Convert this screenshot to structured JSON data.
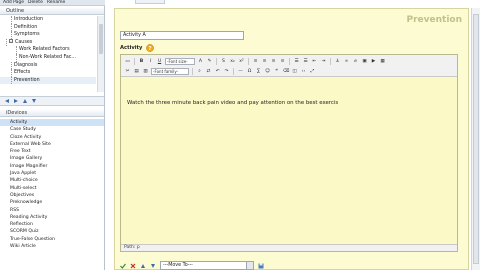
{
  "menu": {
    "items": [
      "Add Page",
      "Delete",
      "Rename"
    ]
  },
  "outline": {
    "title": "Outline",
    "items": [
      {
        "label": "Introduction",
        "indent": 2
      },
      {
        "label": "Definition",
        "indent": 2
      },
      {
        "label": "Symptoms",
        "indent": 2
      },
      {
        "label": "Causes",
        "indent": 1,
        "expander": "-"
      },
      {
        "label": "Work Related Factors",
        "indent": 3
      },
      {
        "label": "Non-Work Related Fac...",
        "indent": 3
      },
      {
        "label": "Diagnosis",
        "indent": 2
      },
      {
        "label": "Effects",
        "indent": 2
      },
      {
        "label": "Prevention",
        "indent": 2,
        "selected": true
      }
    ]
  },
  "devices": {
    "title": "iDevices",
    "items": [
      "Activity",
      "Case Study",
      "Cloze Activity",
      "External Web Site",
      "Free Text",
      "Image Gallery",
      "Image Magnifier",
      "Java Applet",
      "Multi-choice",
      "Multi-select",
      "Objectives",
      "Preknowledge",
      "RSS",
      "Reading Activity",
      "Reflection",
      "SCORM Quiz",
      "True-False Question",
      "Wiki Article"
    ],
    "selected_index": 0
  },
  "idevice": {
    "heading": "Prevention",
    "title_value": "Activity A",
    "activity_label": "Activity",
    "font_size_label": "-Font size-",
    "font_family_label": "-Font family-",
    "editor_text": "Watch the three minute back pain video and pay attention on the best exercis",
    "path_label": "Path: p",
    "move_to_label": "---Move To---"
  },
  "colors": {
    "idevice_bg": "#fdfbd1",
    "heading": "#c2c08c",
    "selection": "#cfe1f5"
  }
}
